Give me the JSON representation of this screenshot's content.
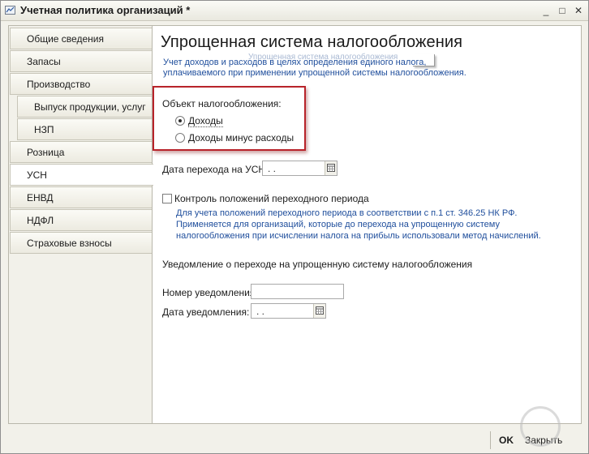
{
  "window": {
    "title": "Учетная политика организаций *",
    "minimize_label": "_",
    "maximize_label": "□",
    "close_label": "✕"
  },
  "sidebar": {
    "items": [
      {
        "label": "Общие сведения"
      },
      {
        "label": "Запасы"
      },
      {
        "label": "Производство"
      },
      {
        "label": "Выпуск продукции, услуг"
      },
      {
        "label": "НЗП"
      },
      {
        "label": "Розница"
      },
      {
        "label": "УСН"
      },
      {
        "label": "ЕНВД"
      },
      {
        "label": "НДФЛ"
      },
      {
        "label": "Страховые взносы"
      }
    ],
    "active_index": 6
  },
  "main": {
    "title": "Упрощенная система налогообложения",
    "ghost_text": "Упрощенная система налогообложения",
    "description_line1": "Учет доходов и расходов в целях определения единого налога,",
    "description_line2": "уплачиваемого при применении упрощенной системы налогообложения.",
    "tax_object": {
      "label": "Объект налогообложения:",
      "options": [
        "Доходы",
        "Доходы минус расходы"
      ],
      "selected_index": 0
    },
    "transition_date": {
      "label": "Дата перехода на УСН:",
      "value": " .  ."
    },
    "transition_control": {
      "label": "Контроль положений переходного периода",
      "checked": false,
      "note_line1": "Для учета положений переходного периода в соответствии с п.1 ст. 346.25 НК РФ.",
      "note_line2": "Применяется для организаций, которые до перехода на упрощенную систему",
      "note_line3": "налогообложения при исчислении налога на прибыль использовали метод начислений."
    },
    "notification": {
      "heading": "Уведомление о переходе на упрощенную систему налогообложения",
      "number_label": "Номер уведомления:",
      "number_value": "",
      "date_label": "Дата уведомления:",
      "date_value": " .  ."
    }
  },
  "footer": {
    "ok_label": "OK",
    "close_label": "Закрыть"
  }
}
